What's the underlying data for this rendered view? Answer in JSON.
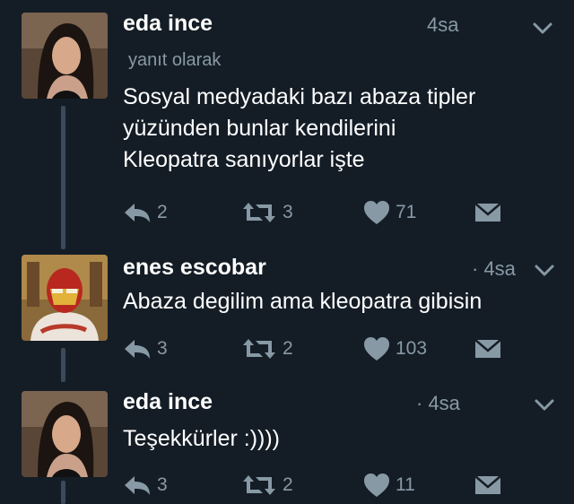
{
  "tweets": [
    {
      "author": "eda ince",
      "time": "4sa",
      "reply_label": "yanıt olarak",
      "text": "Sosyal medyadaki bazı abaza tipler\nyüzünden bunlar kendilerini\nKleopatra sanıyorlar işte",
      "replies": "2",
      "retweets": "3",
      "likes": "71"
    },
    {
      "author": "enes escobar",
      "time": "· 4sa",
      "text": "Abaza degilim ama kleopatra gibisin",
      "replies": "3",
      "retweets": "2",
      "likes": "103"
    },
    {
      "author": "eda ince",
      "time": "· 4sa",
      "text": "Teşekkürler :))))",
      "replies": "3",
      "retweets": "2",
      "likes": "11"
    }
  ],
  "icons": {
    "reply": "reply-icon",
    "retweet": "retweet-icon",
    "like": "heart-icon",
    "dm": "direct-message-icon",
    "menu": "chevron-down-icon"
  },
  "colors": {
    "background": "#141d26",
    "muted": "#8899a6",
    "thread_line": "#3b4a5a"
  }
}
